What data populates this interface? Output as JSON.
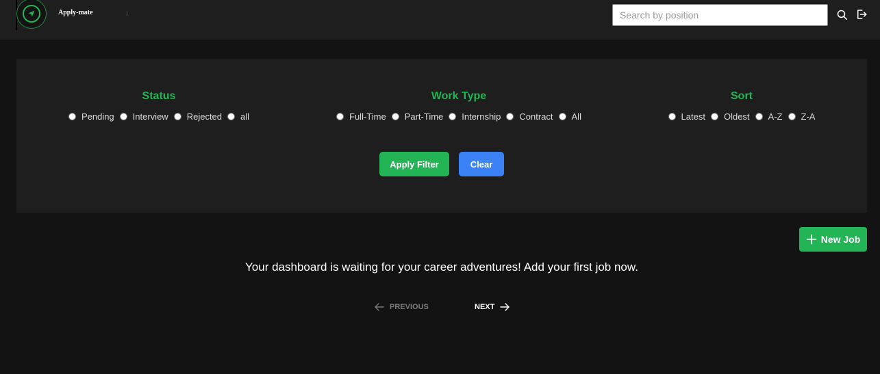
{
  "navbar": {
    "brand": "Apply-mate",
    "logo_icon": "navigation-arrow-icon",
    "search_placeholder": "Search by position",
    "search_value": "",
    "icons": [
      "search-icon",
      "logout-icon"
    ]
  },
  "filters": {
    "status": {
      "title": "Status",
      "options": [
        "Pending",
        "Interview",
        "Rejected",
        "all"
      ]
    },
    "work_type": {
      "title": "Work Type",
      "options": [
        "Full-Time",
        "Part-Time",
        "Internship",
        "Contract",
        "All"
      ]
    },
    "sort": {
      "title": "Sort",
      "options": [
        "Latest",
        "Oldest",
        "A-Z",
        "Z-A"
      ]
    },
    "apply_label": "Apply Filter",
    "clear_label": "Clear"
  },
  "main": {
    "new_job_label": "New Job",
    "empty_message": "Your dashboard is waiting for your career adventures! Add your first job now.",
    "pagination": {
      "previous_label": "PREVIOUS",
      "next_label": "NEXT"
    }
  },
  "colors": {
    "accent_green": "#22b455",
    "accent_blue": "#3b82f6",
    "background": "#131313",
    "panel": "#1e1e1e"
  }
}
